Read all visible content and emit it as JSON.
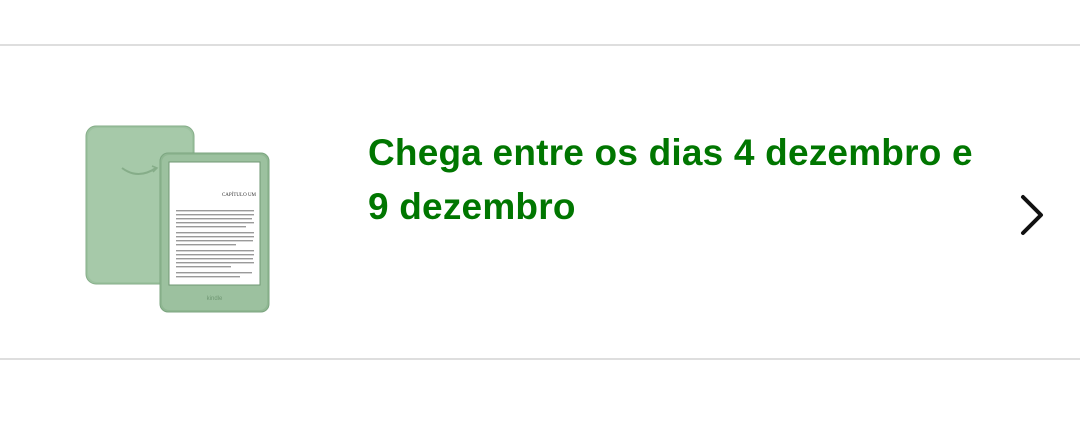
{
  "delivery": {
    "message": "Chega entre os dias 4 dezembro e 9 dezembro",
    "color": "#007600"
  },
  "product": {
    "icon": "kindle-device-image",
    "screen_heading": "CAPÍTULO UM",
    "screen_brand": "kindle",
    "device_color": "#9dc2a1"
  },
  "navigation": {
    "icon": "chevron-right-icon"
  }
}
